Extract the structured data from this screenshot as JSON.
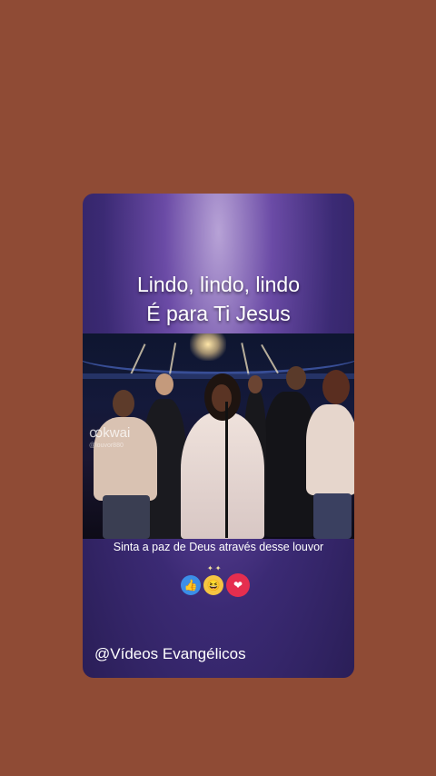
{
  "caption": {
    "line1": "Lindo, lindo, lindo",
    "line2": "É para Ti Jesus"
  },
  "video": {
    "watermark": "kwai",
    "watermark_handle": "@louvor880"
  },
  "subtitle": "Sinta a paz de Deus através desse louvor",
  "reactions": [
    {
      "name": "like-icon",
      "glyph": "👍"
    },
    {
      "name": "haha-icon",
      "glyph": "😆"
    },
    {
      "name": "love-icon",
      "glyph": "❤"
    }
  ],
  "channel_handle": "@Vídeos Evangélicos",
  "colors": {
    "background": "#8f4b35",
    "card": "#3b2a74"
  }
}
